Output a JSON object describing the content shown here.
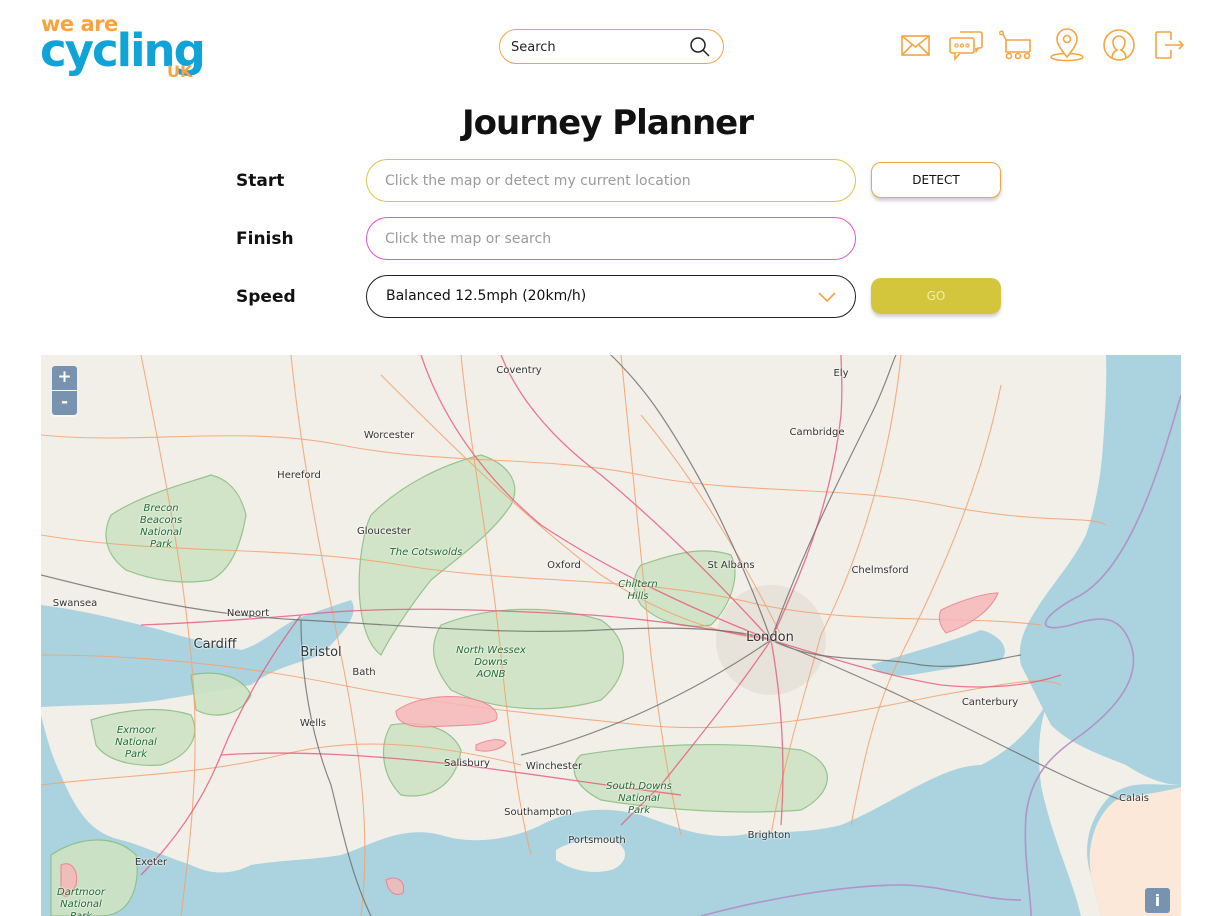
{
  "header": {
    "logo": {
      "line1": "we are",
      "line2": "cycling",
      "line3": "UK"
    },
    "search": {
      "placeholder": "Search"
    },
    "nav_icons": [
      {
        "name": "mail-icon"
      },
      {
        "name": "chat-icon"
      },
      {
        "name": "cart-icon"
      },
      {
        "name": "location-pin-icon"
      },
      {
        "name": "user-profile-icon"
      },
      {
        "name": "logout-icon"
      }
    ]
  },
  "page": {
    "title": "Journey Planner"
  },
  "form": {
    "start": {
      "label": "Start",
      "placeholder": "Click the map or detect my current location",
      "value": ""
    },
    "finish": {
      "label": "Finish",
      "placeholder": "Click the map or search",
      "value": ""
    },
    "speed": {
      "label": "Speed",
      "selected": "Balanced 12.5mph (20km/h)"
    },
    "detect_label": "DETECT",
    "go_label": "GO"
  },
  "map": {
    "zoom_in": "+",
    "zoom_out": "-",
    "info": "i",
    "places": [
      {
        "name": "Coventry",
        "big": false
      },
      {
        "name": "Ely",
        "big": false
      },
      {
        "name": "Worcester",
        "big": false
      },
      {
        "name": "Cambridge",
        "big": false
      },
      {
        "name": "Hereford",
        "big": false
      },
      {
        "name": "Gloucester",
        "big": false
      },
      {
        "name": "Oxford",
        "big": false
      },
      {
        "name": "St Albans",
        "big": false
      },
      {
        "name": "Chelmsford",
        "big": false
      },
      {
        "name": "Swansea",
        "big": false
      },
      {
        "name": "Newport",
        "big": false
      },
      {
        "name": "Cardiff",
        "big": true
      },
      {
        "name": "Bristol",
        "big": true
      },
      {
        "name": "London",
        "big": true
      },
      {
        "name": "Bath",
        "big": false
      },
      {
        "name": "Wells",
        "big": false
      },
      {
        "name": "Canterbury",
        "big": false
      },
      {
        "name": "Salisbury",
        "big": false
      },
      {
        "name": "Winchester",
        "big": false
      },
      {
        "name": "Southampton",
        "big": false
      },
      {
        "name": "Portsmouth",
        "big": false
      },
      {
        "name": "Brighton",
        "big": false
      },
      {
        "name": "Calais",
        "big": false
      },
      {
        "name": "Exeter",
        "big": false
      }
    ],
    "parks": [
      {
        "name": "Brecon\nBeacons\nNational\nPark"
      },
      {
        "name": "The Cotswolds"
      },
      {
        "name": "Chiltern\nHills"
      },
      {
        "name": "North Wessex\nDowns\nAONB"
      },
      {
        "name": "Exmoor\nNational\nPark"
      },
      {
        "name": "South Downs\nNational\nPark"
      },
      {
        "name": "Dartmoor\nNational\nPark"
      }
    ]
  }
}
